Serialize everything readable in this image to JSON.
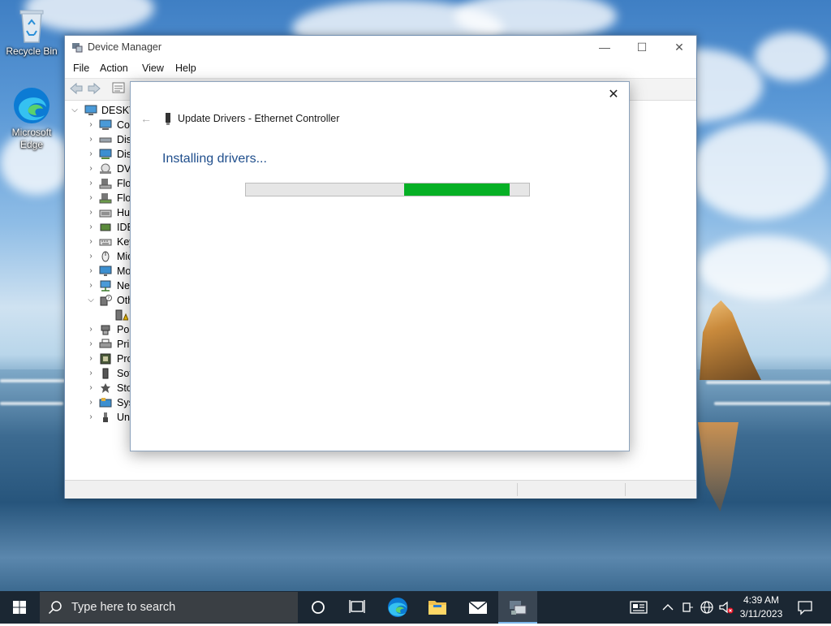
{
  "desktop": {
    "icons": [
      {
        "label": "Recycle Bin",
        "icon": "recycle-bin-icon"
      },
      {
        "label": "Microsoft Edge",
        "icon": "edge-icon"
      }
    ]
  },
  "device_manager": {
    "title": "Device Manager",
    "menu": [
      "File",
      "Action",
      "View",
      "Help"
    ],
    "tree": {
      "root": "DESKTOP",
      "items": [
        "Cor",
        "Disk",
        "Disp",
        "DVD",
        "Flop",
        "Flop",
        "Hun",
        "IDE",
        "Key",
        "Mic",
        "Mo",
        "Net",
        "Oth",
        "",
        "Por",
        "Prir",
        "Pro",
        "Sof",
        "Sto",
        "Syst",
        "Uni"
      ]
    }
  },
  "update_dialog": {
    "title": "Update Drivers - Ethernet Controller",
    "heading": "Installing drivers...",
    "progress": {
      "segment_start": 0.56,
      "segment_end": 0.93,
      "color": "#06b025"
    },
    "close_glyph": "✕",
    "back_glyph": "←"
  },
  "taskbar": {
    "search_placeholder": "Type here to search",
    "clock": {
      "time": "4:39 AM",
      "date": "3/11/2023"
    },
    "pinned": [
      {
        "name": "cortana",
        "icon": "cortana-icon"
      },
      {
        "name": "task-view",
        "icon": "task-view-icon"
      },
      {
        "name": "edge",
        "icon": "edge-icon"
      },
      {
        "name": "file-explorer",
        "icon": "file-explorer-icon"
      },
      {
        "name": "mail",
        "icon": "mail-icon"
      },
      {
        "name": "device-manager",
        "icon": "device-manager-icon",
        "active": true
      }
    ]
  }
}
